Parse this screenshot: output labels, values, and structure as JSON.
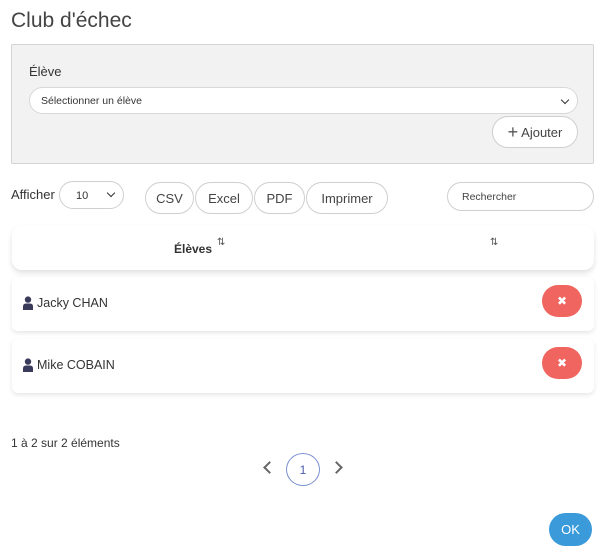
{
  "title": "Club d'échec",
  "student_picker": {
    "label": "Élève",
    "select_value": "Sélectionner un élève",
    "add_button": "Ajouter"
  },
  "controls": {
    "show_label": "Afficher",
    "page_length": "10",
    "export_buttons": [
      "CSV",
      "Excel",
      "PDF",
      "Imprimer"
    ],
    "search_placeholder": "Rechercher"
  },
  "table": {
    "columns": [
      "Élèves",
      ""
    ],
    "rows": [
      {
        "name": "Jacky CHAN",
        "delete_icon": "times-icon"
      },
      {
        "name": "Mike COBAIN",
        "delete_icon": "times-icon"
      }
    ]
  },
  "footer": {
    "info": "1 à 2 sur 2 éléments",
    "current_page": "1",
    "ok_button": "OK"
  },
  "colors": {
    "danger": "#f0655f",
    "primary": "#3b9ad9",
    "pager": "#4a5ba8"
  }
}
